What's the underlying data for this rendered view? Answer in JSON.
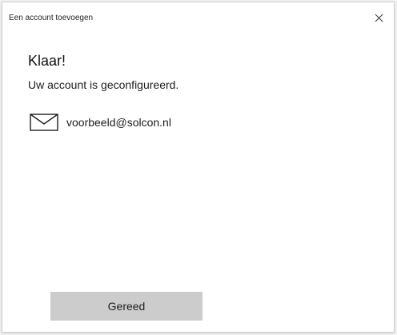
{
  "window": {
    "title": "Een account toevoegen",
    "close_icon": "close-icon"
  },
  "content": {
    "heading": "Klaar!",
    "subheading": "Uw account is geconfigureerd.",
    "account": {
      "icon": "mail-icon",
      "email": "voorbeeld@solcon.nl"
    }
  },
  "actions": {
    "done_label": "Gereed"
  },
  "colors": {
    "background": "#f3f3f3",
    "dialog": "#ffffff",
    "button": "#cccccc",
    "text": "#1a1a1a"
  }
}
